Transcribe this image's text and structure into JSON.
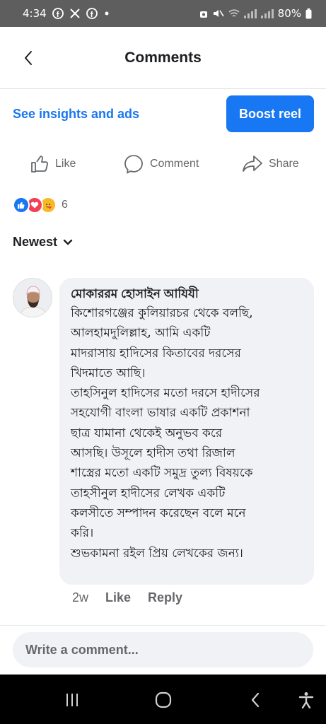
{
  "status_bar": {
    "time": "4:34",
    "left_icons": [
      "facebook-icon",
      "gallery-icon",
      "facebook-icon",
      "dot-icon"
    ],
    "battery": "80%"
  },
  "header": {
    "title": "Comments"
  },
  "insights": {
    "link_label": "See insights and ads",
    "boost_label": "Boost reel"
  },
  "actions": {
    "like_label": "Like",
    "comment_label": "Comment",
    "share_label": "Share"
  },
  "reactions": {
    "types": [
      "like",
      "love",
      "care"
    ],
    "count": "6"
  },
  "sort": {
    "label": "Newest"
  },
  "comment": {
    "author": "মোকাররম হোসাইন আযিযী",
    "text": "কিশোরগঞ্জের কুলিয়ারচর থেকে বলছি,\nআলহামদুলিল্লাহ, আমি একটি\nমাদরাসায় হাদিসের কিতাবের দরসের\nখিদমাতে আছি।\nতাহসিনুল হাদিসের মতো দরসে হাদীসের\nসহযোগী বাংলা ভাষার একটি প্রকাশনা\nছাত্র যামানা থেকেই অনুভব করে\nআসছি। উসূলে হাদীস তথা রিজাল\nশাস্ত্রের মতো একটি সমুদ্র তুল্য বিষয়কে\nতাহসীনুল হাদীসের লেখক একটি\nকলসীতে সম্পাদন করেছেন বলে মনে\nকরি।\nশুভকামনা রইল প্রিয় লেখকের জন্য।",
    "time": "2w",
    "like_label": "Like",
    "reply_label": "Reply"
  },
  "composer": {
    "placeholder": "Write a comment..."
  },
  "colors": {
    "accent": "#1877f2",
    "bubble": "#f0f2f5",
    "secondary_text": "#65676b",
    "love": "#f33e58",
    "care": "#f7b928"
  }
}
